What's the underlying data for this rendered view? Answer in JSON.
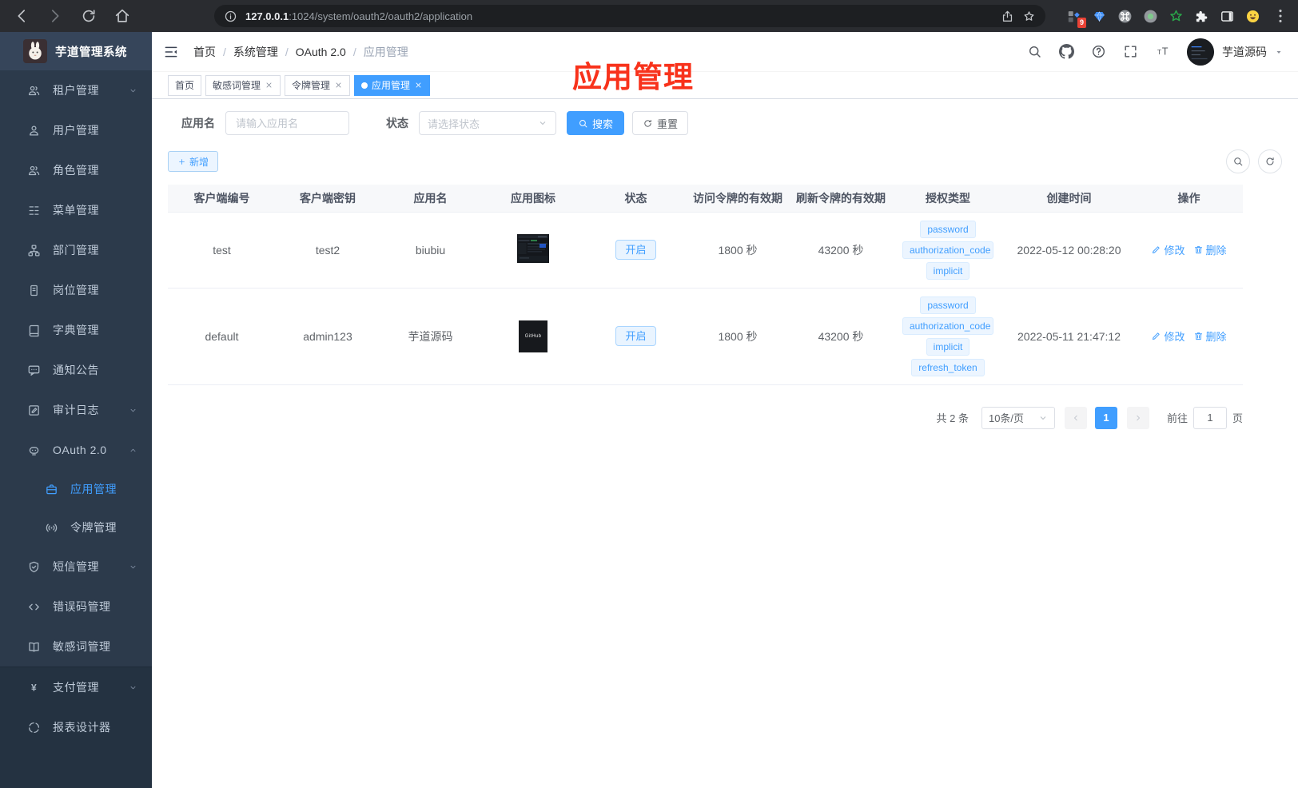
{
  "colors": {
    "accent": "#409eff",
    "annotation": "#f8321b",
    "sidebar_bg": "#2c3a4b",
    "sidebar_bottom_bg": "#243241",
    "logo_bg": "#36455a",
    "tab_active_bg": "#409eff",
    "tag_bg": "#ecf5ff",
    "tag_text": "#409eff",
    "table_header_bg": "#f7f8fa",
    "chrome_bg": "#2a2c30"
  },
  "browser": {
    "url_host": "127.0.0.1",
    "url_rest": ":1024/system/oauth2/oauth2/application",
    "ext_badge": "9"
  },
  "sidebar": {
    "title": "芋道管理系统",
    "items": [
      {
        "id": "tenant",
        "icon": "users",
        "label": "租户管理",
        "chevron": "down"
      },
      {
        "id": "user",
        "icon": "user",
        "label": "用户管理"
      },
      {
        "id": "role",
        "icon": "users",
        "label": "角色管理"
      },
      {
        "id": "menu",
        "icon": "tree",
        "label": "菜单管理"
      },
      {
        "id": "dept",
        "icon": "org",
        "label": "部门管理"
      },
      {
        "id": "post",
        "icon": "idcard",
        "label": "岗位管理"
      },
      {
        "id": "dict",
        "icon": "dict",
        "label": "字典管理"
      },
      {
        "id": "notice",
        "icon": "message",
        "label": "通知公告"
      },
      {
        "id": "audit-log",
        "icon": "log",
        "label": "审计日志",
        "chevron": "down"
      },
      {
        "id": "oauth2",
        "icon": "robot",
        "label": "OAuth 2.0",
        "chevron": "up"
      },
      {
        "id": "oauth2-application",
        "icon": "briefcase",
        "label": "应用管理",
        "child": true,
        "active": true
      },
      {
        "id": "oauth2-token",
        "icon": "signal",
        "label": "令牌管理",
        "child": true
      },
      {
        "id": "sms",
        "icon": "shield",
        "label": "短信管理",
        "chevron": "down"
      },
      {
        "id": "error-code",
        "icon": "code",
        "label": "错误码管理"
      },
      {
        "id": "sensitive-word",
        "icon": "openbook",
        "label": "敏感词管理"
      },
      {
        "id": "pay",
        "icon": "yen",
        "label": "支付管理",
        "chevron": "down",
        "section": 2
      },
      {
        "id": "report-designer",
        "icon": "compass",
        "label": "报表设计器",
        "section": 2
      }
    ]
  },
  "header": {
    "breadcrumb": [
      "首页",
      "系统管理",
      "OAuth 2.0",
      "应用管理"
    ],
    "separator": "/",
    "user_name": "芋道源码"
  },
  "tabs": [
    {
      "label": "首页",
      "closable": false,
      "active": false
    },
    {
      "label": "敏感词管理",
      "closable": true,
      "active": false
    },
    {
      "label": "令牌管理",
      "closable": true,
      "active": false
    },
    {
      "label": "应用管理",
      "closable": true,
      "active": true
    }
  ],
  "annotation": {
    "text": "应用管理"
  },
  "filter": {
    "name_label": "应用名",
    "name_placeholder": "请输入应用名",
    "status_label": "状态",
    "status_placeholder": "请选择状态",
    "search_label": "搜索",
    "reset_label": "重置",
    "add_label": "新增"
  },
  "table": {
    "headers": [
      "客户端编号",
      "客户端密钥",
      "应用名",
      "应用图标",
      "状态",
      "访问令牌的有效期",
      "刷新令牌的有效期",
      "授权类型",
      "创建时间",
      "操作"
    ],
    "edit_label": "修改",
    "delete_label": "删除",
    "rows": [
      {
        "client_id": "test",
        "client_secret": "test2",
        "app_name": "biubiu",
        "icon_type": "screenshot",
        "status": "开启",
        "access_ttl": "1800 秒",
        "refresh_ttl": "43200 秒",
        "grants": [
          "password",
          "authorization_code",
          "implicit"
        ],
        "created": "2022-05-12 00:28:20"
      },
      {
        "client_id": "default",
        "client_secret": "admin123",
        "app_name": "芋道源码",
        "icon_type": "dark-logo",
        "icon_text": "GitHub",
        "status": "开启",
        "access_ttl": "1800 秒",
        "refresh_ttl": "43200 秒",
        "grants": [
          "password",
          "authorization_code",
          "implicit",
          "refresh_token"
        ],
        "created": "2022-05-11 21:47:12"
      }
    ]
  },
  "pagination": {
    "total": "共 2 条",
    "page_size": "10条/页",
    "current_page": "1",
    "goto_label": "前往",
    "goto_value": "1",
    "page_unit": "页"
  }
}
